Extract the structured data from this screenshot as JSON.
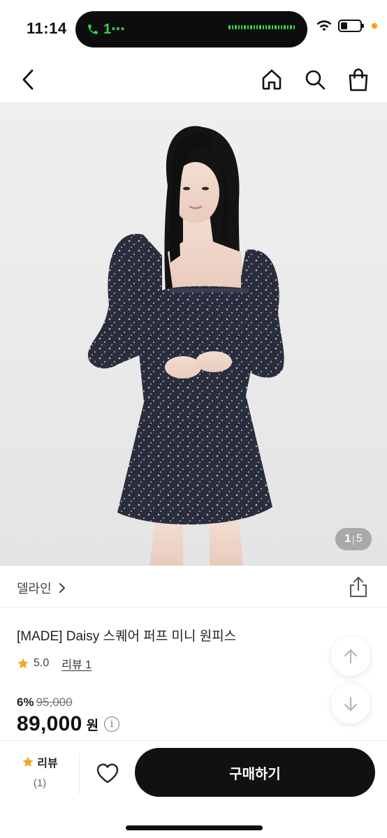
{
  "status_bar": {
    "time": "11:14",
    "call_label": "1⋯",
    "wifi_icon": "wifi-icon",
    "battery_level": 0.35,
    "call_color": "#32d74b",
    "indicator_color": "#ff9f0a"
  },
  "nav": {
    "back_icon": "chevron-left-icon",
    "home_icon": "home-icon",
    "search_icon": "search-icon",
    "cart_icon": "shopping-bag-icon"
  },
  "gallery": {
    "current": "1",
    "separator": "|",
    "total": "5"
  },
  "brand": {
    "name": "델라인",
    "chevron": "›"
  },
  "product": {
    "title": "[MADE] Daisy 스퀘어 퍼프 미니 원피스",
    "rating": "5.0",
    "review_link": "리뷰 1",
    "discount_rate": "6%",
    "original_price": "95,000",
    "sale_price": "89,000",
    "currency": "원",
    "info_symbol": "i",
    "star_color": "#f5a623"
  },
  "bottom_bar": {
    "review_label": "리뷰",
    "review_count": "(1)",
    "buy_label": "구매하기"
  }
}
